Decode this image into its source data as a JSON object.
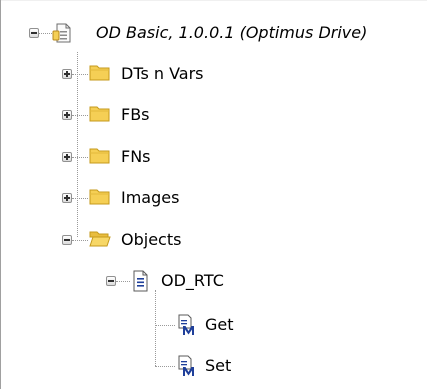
{
  "tree": {
    "root": {
      "label": "OD Basic, 1.0.0.1 (Optimus Drive)",
      "expanded": true,
      "icon": "document-properties-icon"
    },
    "folders": [
      {
        "label": "DTs n Vars",
        "expanded": false,
        "icon": "folder-icon"
      },
      {
        "label": "FBs",
        "expanded": false,
        "icon": "folder-icon"
      },
      {
        "label": "FNs",
        "expanded": false,
        "icon": "folder-icon"
      },
      {
        "label": "Images",
        "expanded": false,
        "icon": "folder-icon"
      },
      {
        "label": "Objects",
        "expanded": true,
        "icon": "folder-icon"
      }
    ],
    "object": {
      "label": "OD_RTC",
      "expanded": true,
      "icon": "text-document-icon"
    },
    "methods": [
      {
        "label": "Get",
        "icon": "method-icon"
      },
      {
        "label": "Set",
        "icon": "method-icon"
      }
    ]
  },
  "colors": {
    "folder_fill": "#f5cf55",
    "folder_edge": "#c59a1b",
    "method_blue": "#1f3f9a",
    "connector": "#9a9a9a"
  }
}
